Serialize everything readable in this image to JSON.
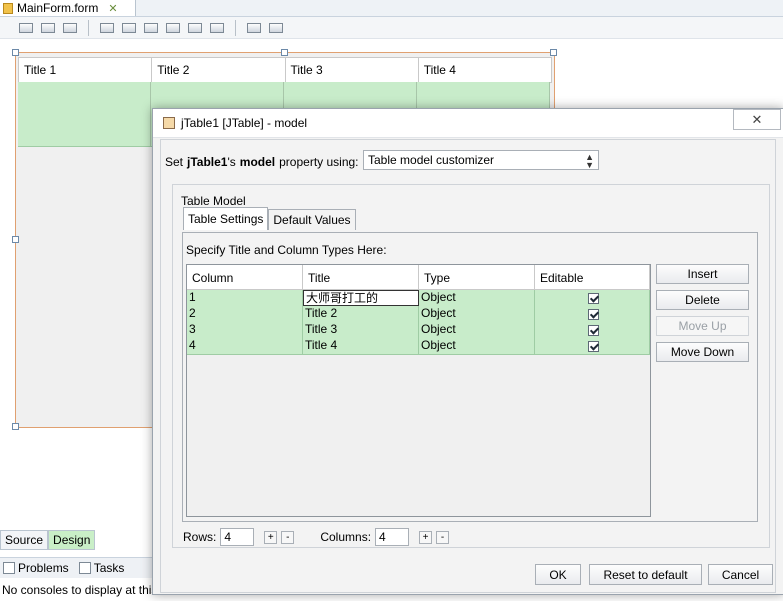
{
  "editor": {
    "tab_title": "MainForm.form",
    "toolbar_icons": [
      "selection-mode-icon",
      "connection-mode-icon",
      "preview-design-icon",
      "align-left-icon",
      "align-right-icon",
      "center-horizontally-icon",
      "align-top-icon",
      "align-bottom-icon",
      "center-vertically-icon",
      "resize-horizontally-icon",
      "resize-vertically-icon"
    ]
  },
  "design_table": {
    "columns": [
      "Title 1",
      "Title 2",
      "Title 3",
      "Title 4"
    ],
    "row_count": 4
  },
  "view_tabs": {
    "source": "Source",
    "design": "Design"
  },
  "bottom_panel": {
    "tabs": [
      "Problems",
      "Tasks"
    ],
    "message": "No consoles to display at this"
  },
  "dialog": {
    "title": "jTable1 [JTable] - model",
    "close_glyph": "✕",
    "property_prefix": "Set",
    "component_name": "jTable1",
    "apostrophe_s": "'s",
    "property_name": "model",
    "property_suffix": "property using:",
    "customizer_value": "Table model customizer",
    "group_label": "Table Model",
    "tabs": [
      "Table Settings",
      "Default Values"
    ],
    "panel_label": "Specify Title and Column Types Here:",
    "grid_headers": [
      "Column",
      "Title",
      "Type",
      "Editable"
    ],
    "grid_rows": [
      {
        "column": "1",
        "title": "大师哥打工的",
        "type": "Object",
        "editable": true
      },
      {
        "column": "2",
        "title": "Title 2",
        "type": "Object",
        "editable": true
      },
      {
        "column": "3",
        "title": "Title 3",
        "type": "Object",
        "editable": true
      },
      {
        "column": "4",
        "title": "Title 4",
        "type": "Object",
        "editable": true
      }
    ],
    "side_buttons": {
      "insert": "Insert",
      "delete": "Delete",
      "move_up": "Move Up",
      "move_down": "Move Down"
    },
    "rows_label": "Rows:",
    "rows_value": "4",
    "columns_label": "Columns:",
    "columns_value": "4",
    "plus": "+",
    "minus": "-",
    "ok": "OK",
    "reset": "Reset to default",
    "cancel": "Cancel"
  },
  "colors": {
    "row_green": "#c8ecca",
    "accent_orange": "#e0a070"
  }
}
